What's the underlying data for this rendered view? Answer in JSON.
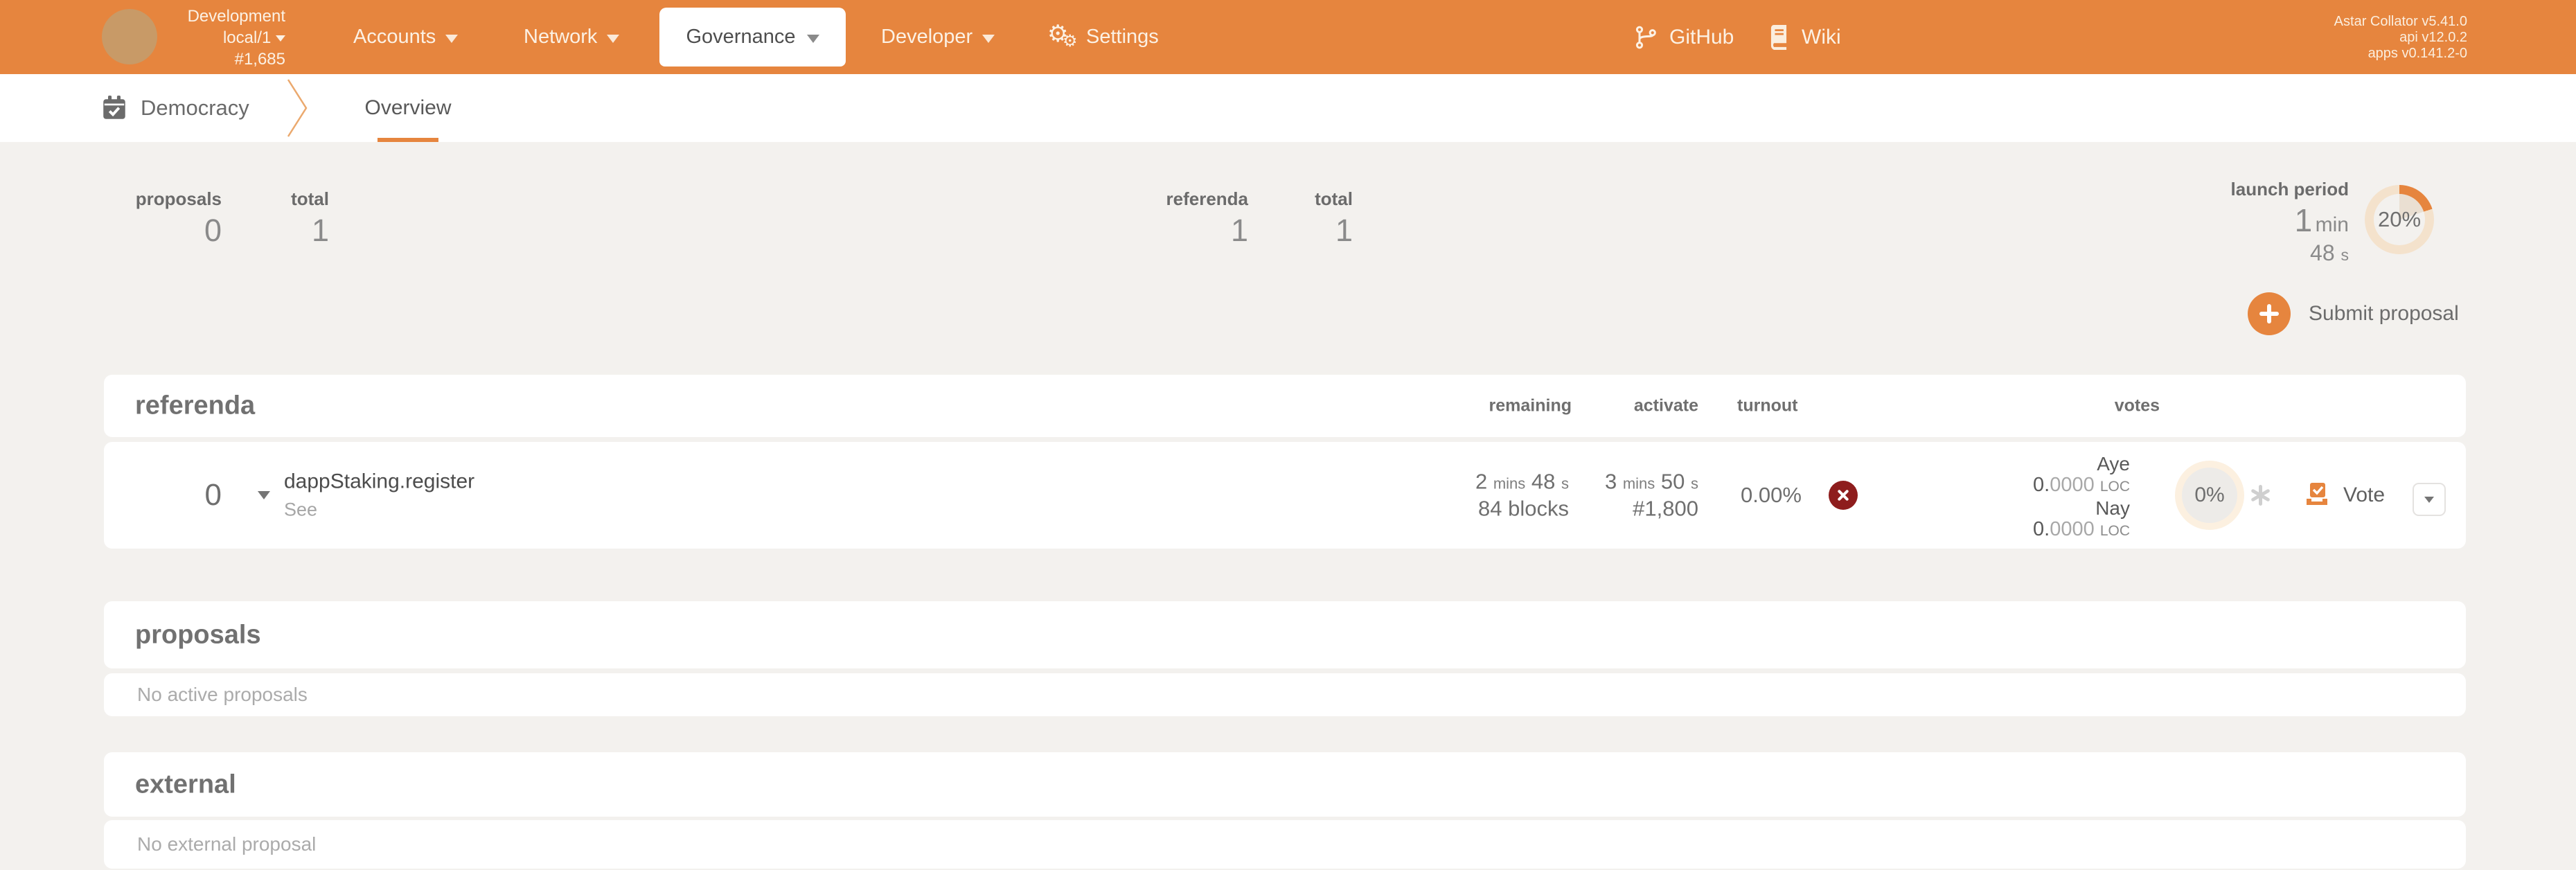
{
  "header": {
    "chain_name": "Development",
    "network": "local/1",
    "block_number": "#1,685",
    "nav": [
      {
        "label": "Accounts"
      },
      {
        "label": "Network"
      },
      {
        "label": "Governance",
        "active": true
      },
      {
        "label": "Developer"
      }
    ],
    "settings_label": "Settings",
    "github_label": "GitHub",
    "wiki_label": "Wiki",
    "version_node": "Astar Collator v5.41.0",
    "version_api": "api v12.0.2",
    "version_apps": "apps v0.141.2-0"
  },
  "tabbar": {
    "section_label": "Democracy",
    "tabs": [
      {
        "label": "Overview",
        "active": true
      }
    ]
  },
  "summary": {
    "proposals_label": "proposals",
    "proposals_value": "0",
    "proposals_total_label": "total",
    "proposals_total_value": "1",
    "referenda_label": "referenda",
    "referenda_value": "1",
    "referenda_total_label": "total",
    "referenda_total_value": "1",
    "launch_period": {
      "label": "launch period",
      "value": "1",
      "unit": "min",
      "sub_value": "48",
      "sub_unit": "s",
      "percent": "20%",
      "percent_value": 20
    }
  },
  "actions": {
    "submit_proposal_label": "Submit proposal"
  },
  "referenda": {
    "title": "referenda",
    "columns": {
      "remaining": "remaining",
      "activate": "activate",
      "turnout": "turnout",
      "votes": "votes"
    },
    "row": {
      "index": "0",
      "method": "dappStaking.register",
      "preimage_label": "See",
      "remaining": {
        "v1": "2",
        "u1": "mins",
        "v2": "48",
        "u2": "s",
        "b_v": "84",
        "b_u": "blocks"
      },
      "activate": {
        "v1": "3",
        "u1": "mins",
        "v2": "50",
        "u2": "s",
        "block": "#1,800"
      },
      "turnout": "0.00%",
      "votes": {
        "aye_label": "Aye",
        "aye_head": "0.",
        "aye_tail": "0000",
        "aye_unit": "LOC",
        "nay_label": "Nay",
        "nay_head": "0.",
        "nay_tail": "0000",
        "nay_unit": "LOC"
      },
      "approval_percent": "0%",
      "vote_label": "Vote"
    }
  },
  "proposals": {
    "title": "proposals",
    "empty": "No active proposals"
  },
  "external": {
    "title": "external",
    "empty": "No external proposal"
  },
  "colors": {
    "accent": "#e6853e",
    "danger": "#8e1d1d",
    "header_bg": "#e6853e"
  }
}
